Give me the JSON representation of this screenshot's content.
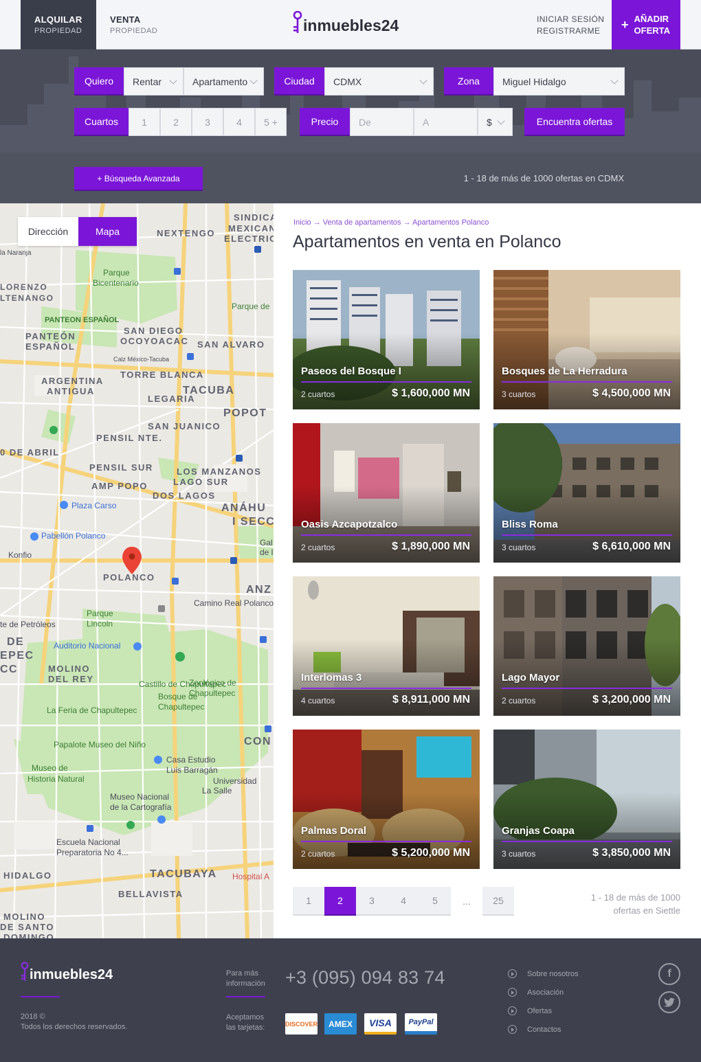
{
  "header": {
    "tabs": [
      {
        "title": "ALQUILAR",
        "sub": "PROPIEDAD"
      },
      {
        "title": "VENTA",
        "sub": "PROPIEDAD"
      }
    ],
    "logo_text": "inmuebles24",
    "login": "INICIAR SESIÓN",
    "register": "REGISTRARME",
    "add_plus": "+",
    "add_line1": "AÑADIR",
    "add_line2": "OFERTA"
  },
  "search": {
    "quiero_label": "Quiero",
    "quiero_value": "Rentar",
    "tipo_value": "Apartamento",
    "ciudad_label": "Ciudad",
    "ciudad_value": "CDMX",
    "zona_label": "Zona",
    "zona_value": "Miguel Hidalgo",
    "cuartos_label": "Cuartos",
    "cuartos": [
      "1",
      "2",
      "3",
      "4",
      "5 +"
    ],
    "precio_label": "Precio",
    "de_placeholder": "De",
    "a_placeholder": "A",
    "moneda": "$",
    "find_button": "Encuentra ofertas",
    "advanced": "+  Búsqueda Avanzada",
    "results_count": "1 - 18 de más de 1000 ofertas en CDMX"
  },
  "map": {
    "tab_direccion": "Dirección",
    "tab_mapa": "Mapa",
    "labels": [
      "SINDICA",
      "MEXICAN",
      "ELECTRIC",
      "NEXTENGO",
      "la Naranja",
      "Parque",
      "Bicentenario",
      "LORENZO",
      "LTENANGO",
      "Parque de",
      "PANTEON ESPAÑOL",
      "SAN DIEGO",
      "OCOYOACAC",
      "PANTEÓN",
      "ESPAÑOL",
      "SAN ALVARO",
      "Calz México-Tacuba",
      "ARGENTINA",
      "ANTIGUA",
      "TORRE BLANCA",
      "LEGARIA",
      "TACUBA",
      "POPOT",
      "PENSIL NTE.",
      "SAN JUANICO",
      "0 DE ABRIL",
      "PENSIL SUR",
      "LOS MANZANOS",
      "AMP POPO",
      "LAGO SUR",
      "DOS LAGOS",
      "ANÁHU",
      "I SECC",
      "Plaza Carso",
      "Pabellón Polanco",
      "Konfio",
      "POLANCO",
      "Gal",
      "de la",
      "ANZ",
      "Camino Real Polanco",
      "Parque",
      "Lincoln",
      "te de Petróleos",
      "DE",
      "EPEC",
      "CC",
      "Auditorio Nacional",
      "Zoológico de",
      "Chapultepec",
      "MOLINO",
      "DEL REY",
      "Castillo de Chapultepec",
      "Bosque de",
      "Chapultepec",
      "La Feria de Chapultepec",
      "CON",
      "Papalote Museo del Niño",
      "Casa Estudio",
      "Luis Barragán",
      "Museo de",
      "Historia Natural",
      "Universidad",
      "La Salle",
      "Museo Nacional",
      "de la Cartografía",
      "Escuela Nacional",
      "Preparatoria No 4...",
      "HIDALGO",
      "TACUBAYA",
      "Hospital A",
      "BELLAVISTA",
      "MOLINO",
      "DE SANTO",
      "DOMINGO"
    ]
  },
  "breadcrumb": "Inicio → Venta de apartamentos → Apartamentos Polanco",
  "page_title": "Apartamentos en venta en Polanco",
  "listings": [
    {
      "name": "Paseos del Bosque I",
      "rooms": "2 cuartos",
      "price": "$ 1,600,000 MN"
    },
    {
      "name": "Bosques de La Herradura",
      "rooms": "3 cuartos",
      "price": "$ 4,500,000 MN"
    },
    {
      "name": "Oasis Azcapotzalco",
      "rooms": "2 cuartos",
      "price": "$ 1,890,000 MN"
    },
    {
      "name": "Bliss Roma",
      "rooms": "3 cuartos",
      "price": "$ 6,610,000 MN"
    },
    {
      "name": "Interlomas 3",
      "rooms": "4 cuartos",
      "price": "$ 8,911,000 MN"
    },
    {
      "name": "Lago Mayor",
      "rooms": "2 cuartos",
      "price": "$ 3,200,000 MN"
    },
    {
      "name": "Palmas Doral",
      "rooms": "2 cuartos",
      "price": "$ 5,200,000 MN"
    },
    {
      "name": "Granjas Coapa",
      "rooms": "3 cuartos",
      "price": "$ 3,850,000 MN"
    }
  ],
  "pagination": {
    "pages": [
      "1",
      "2",
      "3",
      "4",
      "5",
      "...",
      "25"
    ],
    "current": "2"
  },
  "results_line1": "1 - 18 de más de 1000",
  "results_line2": "ofertas en Siettle",
  "footer": {
    "logo_text": "inmuebles24",
    "copy_year": "2018 ©",
    "copy_text": "Todos los derechos reservados.",
    "info_line1": "Para más",
    "info_line2": "información",
    "phone": "+3 (095) 094 83 74",
    "cards_line1": "Aceptamos",
    "cards_line2": "las tarjetas:",
    "cards": [
      "DISCOVER",
      "AMEX",
      "VISA",
      "PayPal"
    ],
    "links": [
      "Sobre nosotros",
      "Asociación",
      "Ofertas",
      "Contactos"
    ]
  },
  "colors": {
    "accent": "#7b16d8",
    "dark_band": "#4a4d59",
    "footer": "#3e414d"
  }
}
